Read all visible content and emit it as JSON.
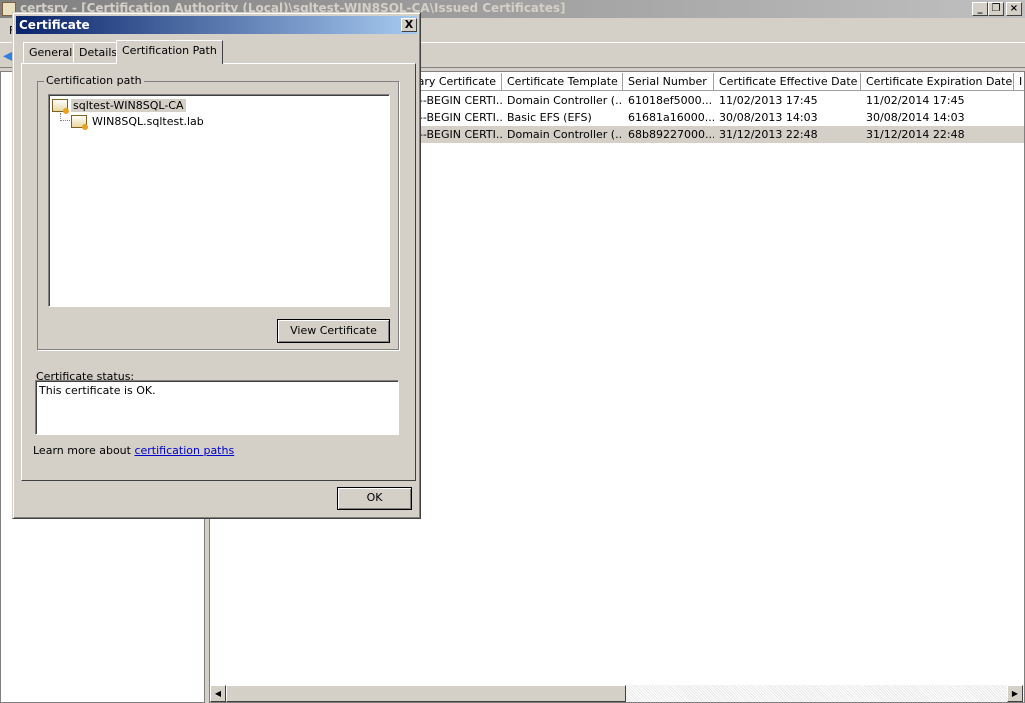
{
  "main_window": {
    "title": "certsrv - [Certification Authority (Local)\\sqltest-WIN8SQL-CA\\Issued Certificates]",
    "menu_first": "F"
  },
  "table": {
    "columns": [
      "Binary Certificate",
      "Certificate Template",
      "Serial Number",
      "Certificate Effective Date",
      "Certificate Expiration Date",
      "I"
    ],
    "rows": [
      [
        "-----BEGIN CERTI...",
        "Domain Controller (...",
        "61018ef5000...",
        "11/02/2013 17:45",
        "11/02/2014 17:45"
      ],
      [
        "-----BEGIN CERTI...",
        "Basic EFS (EFS)",
        "61681a16000...",
        "30/08/2013 14:03",
        "30/08/2014 14:03"
      ],
      [
        "-----BEGIN CERTI...",
        "Domain Controller (...",
        "68b89227000...",
        "31/12/2013 22:48",
        "31/12/2014 22:48"
      ]
    ],
    "selected_row": 2
  },
  "dialog": {
    "title": "Certificate",
    "close": "X",
    "tabs": [
      "General",
      "Details",
      "Certification Path"
    ],
    "active_tab": 2,
    "group_label": "Certification path",
    "tree": [
      "sqltest-WIN8SQL-CA",
      "WIN8SQL.sqltest.lab"
    ],
    "view_button": "View Certificate",
    "status_label": "Certificate status:",
    "status_text": "This certificate is OK.",
    "learn_prefix": "Learn more about ",
    "learn_link": "certification paths",
    "ok": "OK"
  },
  "colors": {
    "title_active_start": "#0a246a",
    "title_active_end": "#a6caf0",
    "face": "#d4d0c8",
    "link": "#0000cc"
  }
}
